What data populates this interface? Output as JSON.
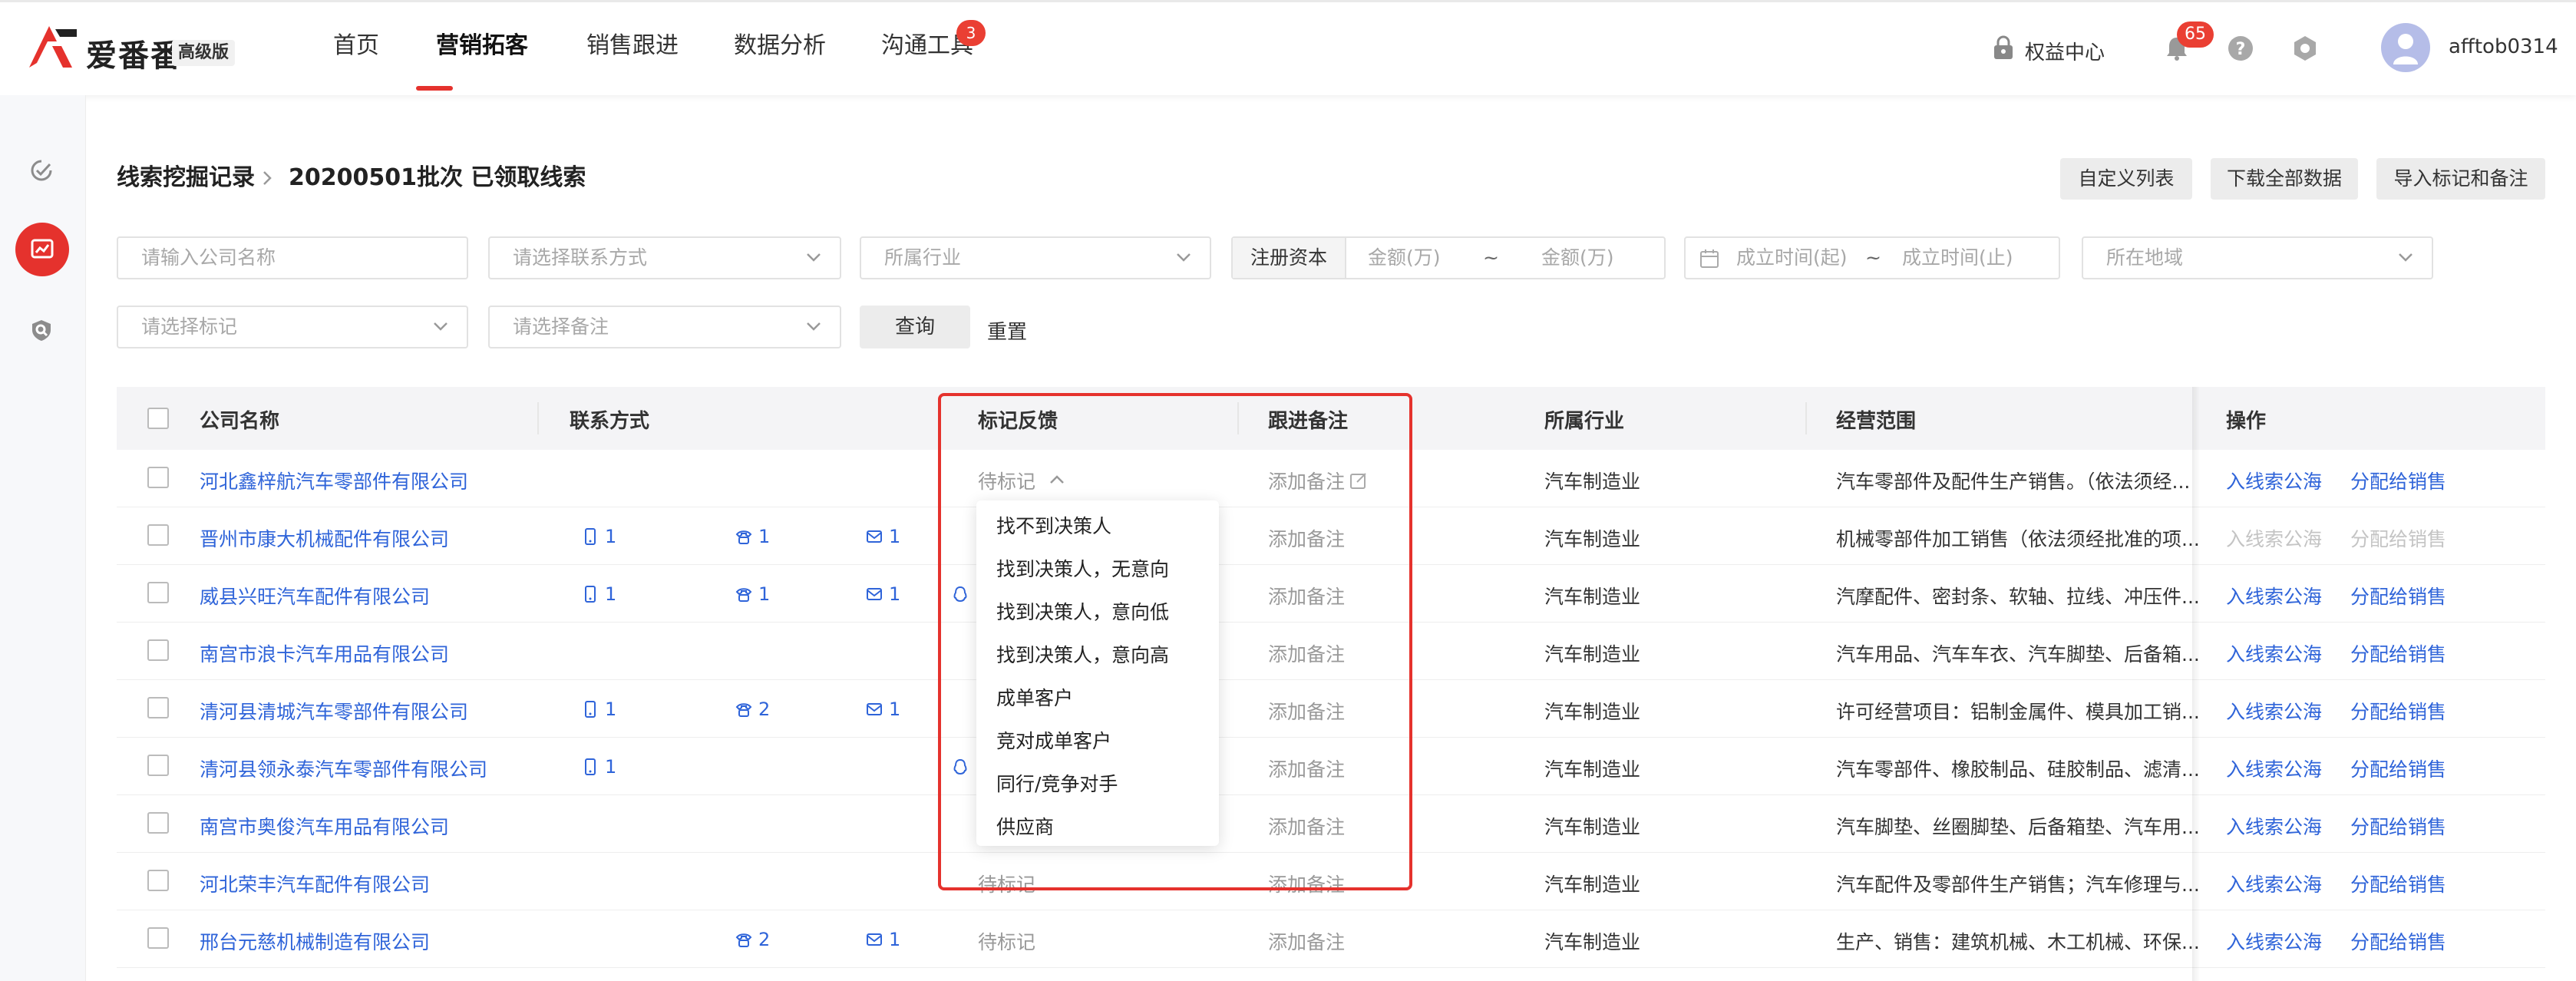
{
  "app": {
    "logo_text": "爱番番",
    "logo_badge": "高级版"
  },
  "nav": {
    "items": [
      "首页",
      "营销拓客",
      "销售跟进",
      "数据分析",
      "沟通工具"
    ],
    "active_index": 1,
    "comm_badge": "3"
  },
  "header_right": {
    "rights_label": "权益中心",
    "bell_count": "65",
    "username": "afftob0314"
  },
  "breadcrumb": {
    "parent": "线索挖掘记录",
    "current": "20200501批次 已领取线索"
  },
  "toolbar": {
    "custom_cols": "自定义列表",
    "download_all": "下载全部数据",
    "import_marks": "导入标记和备注"
  },
  "filters": {
    "company_placeholder": "请输入公司名称",
    "contact_placeholder": "请选择联系方式",
    "industry_placeholder": "所属行业",
    "capital_label": "注册资本",
    "amount_min": "金额(万)",
    "amount_max": "金额(万)",
    "range_sep": "~",
    "date_start": "成立时间(起)",
    "date_end": "成立时间(止)",
    "region_placeholder": "所在地域",
    "mark_placeholder": "请选择标记",
    "note_placeholder": "请选择备注",
    "query": "查询",
    "reset": "重置"
  },
  "table": {
    "headers": {
      "company": "公司名称",
      "contact": "联系方式",
      "mark": "标记反馈",
      "note": "跟进备注",
      "industry": "所属行业",
      "scope": "经营范围",
      "ops": "操作"
    },
    "rows": [
      {
        "company": "河北鑫梓航汽车零部件有限公司",
        "mobile": "",
        "phone": "",
        "email": "",
        "other": "",
        "mark": "待标记",
        "note": "添加备注",
        "industry": "汽车制造业",
        "scope": "汽车零部件及配件生产销售。（依法须经...",
        "op1": "入线索公海",
        "op2": "分配给销售"
      },
      {
        "company": "晋州市康大机械配件有限公司",
        "mobile": "1",
        "phone": "1",
        "email": "1",
        "other": "",
        "mark": "",
        "note": "添加备注",
        "industry": "汽车制造业",
        "scope": "机械零部件加工销售（依法须经批准的项...",
        "op1": "入线索公海",
        "op2": "分配给销售"
      },
      {
        "company": "威县兴旺汽车配件有限公司",
        "mobile": "1",
        "phone": "1",
        "email": "1",
        "other": "1",
        "mark": "",
        "note": "添加备注",
        "industry": "汽车制造业",
        "scope": "汽摩配件、密封条、软轴、拉线、冲压件...",
        "op1": "入线索公海",
        "op2": "分配给销售"
      },
      {
        "company": "南宫市浪卡汽车用品有限公司",
        "mobile": "",
        "phone": "",
        "email": "",
        "other": "",
        "mark": "",
        "note": "添加备注",
        "industry": "汽车制造业",
        "scope": "汽车用品、汽车车衣、汽车脚垫、后备箱...",
        "op1": "入线索公海",
        "op2": "分配给销售"
      },
      {
        "company": "清河县清城汽车零部件有限公司",
        "mobile": "1",
        "phone": "2",
        "email": "1",
        "other": "",
        "mark": "",
        "note": "添加备注",
        "industry": "汽车制造业",
        "scope": "许可经营项目：铝制金属件、模具加工销...",
        "op1": "入线索公海",
        "op2": "分配给销售"
      },
      {
        "company": "清河县领永泰汽车零部件有限公司",
        "mobile": "1",
        "phone": "",
        "email": "",
        "other": "1",
        "mark": "",
        "note": "添加备注",
        "industry": "汽车制造业",
        "scope": "汽车零部件、橡胶制品、硅胶制品、滤清...",
        "op1": "入线索公海",
        "op2": "分配给销售"
      },
      {
        "company": "南宫市奥俊汽车用品有限公司",
        "mobile": "",
        "phone": "",
        "email": "",
        "other": "",
        "mark": "",
        "note": "添加备注",
        "industry": "汽车制造业",
        "scope": "汽车脚垫、丝圈脚垫、后备箱垫、汽车用...",
        "op1": "入线索公海",
        "op2": "分配给销售"
      },
      {
        "company": "河北荣丰汽车配件有限公司",
        "mobile": "",
        "phone": "",
        "email": "",
        "other": "",
        "mark": "待标记",
        "note": "添加备注",
        "industry": "汽车制造业",
        "scope": "汽车配件及零部件生产销售；汽车修理与...",
        "op1": "入线索公海",
        "op2": "分配给销售"
      },
      {
        "company": "邢台元慈机械制造有限公司",
        "mobile": "",
        "phone": "2",
        "email": "1",
        "other": "",
        "mark": "待标记",
        "note": "添加备注",
        "industry": "汽车制造业",
        "scope": "生产、销售：建筑机械、木工机械、环保...",
        "op1": "入线索公海",
        "op2": "分配给销售"
      }
    ]
  },
  "dropdown": {
    "items": [
      "找不到决策人",
      "找到决策人，无意向",
      "找到决策人，意向低",
      "找到决策人，意向高",
      "成单客户",
      "竞对成单客户",
      "同行/竞争对手",
      "供应商"
    ]
  }
}
